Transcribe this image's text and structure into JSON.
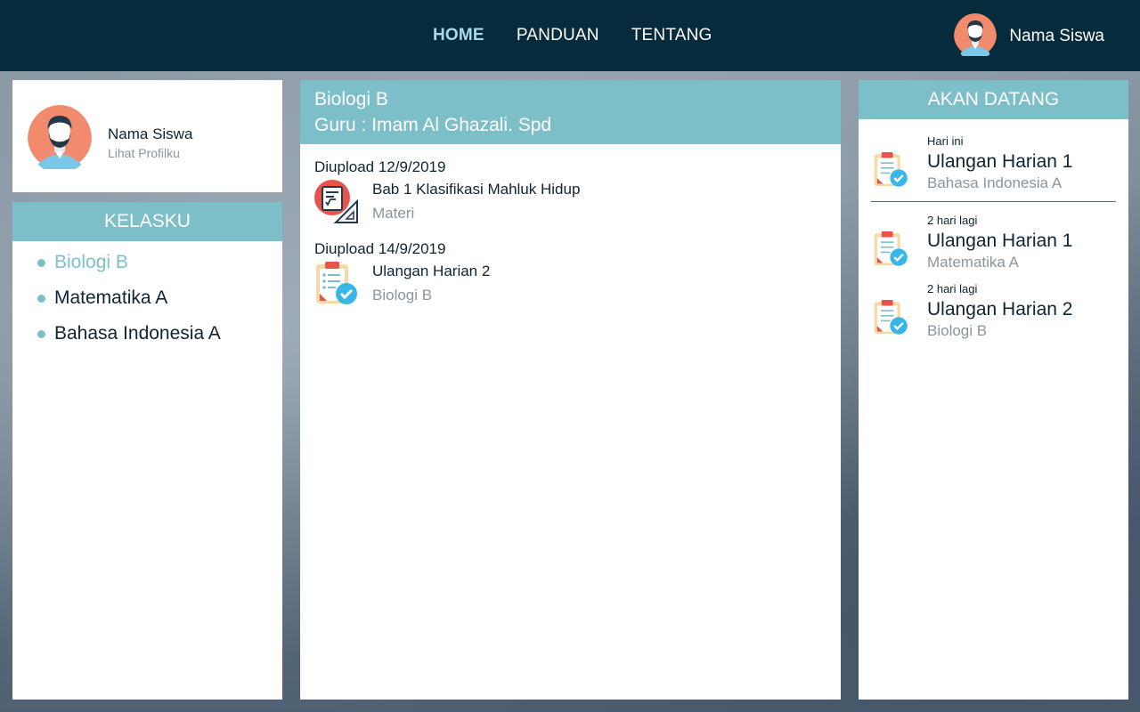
{
  "nav": {
    "items": [
      {
        "label": "HOME",
        "active": true
      },
      {
        "label": "PANDUAN",
        "active": false
      },
      {
        "label": "TENTANG",
        "active": false
      }
    ],
    "user_name": "Nama Siswa"
  },
  "profile": {
    "name": "Nama Siswa",
    "link": "Lihat Profilku"
  },
  "kelasku": {
    "header": "KELASKU",
    "items": [
      {
        "label": "Biologi B",
        "active": true
      },
      {
        "label": "Matematika A",
        "active": false
      },
      {
        "label": "Bahasa Indonesia A",
        "active": false
      }
    ]
  },
  "main": {
    "course": "Biologi B",
    "teacher": "Guru : Imam Al Ghazali. Spd",
    "uploads": [
      {
        "date": "Diupload 12/9/2019",
        "title": "Bab 1 Klasifikasi Mahluk Hidup",
        "sub": "Materi",
        "icon": "material-icon"
      },
      {
        "date": "Diupload 14/9/2019",
        "title": "Ulangan Harian 2",
        "sub": "Biologi B",
        "icon": "quiz-clipboard-icon"
      }
    ]
  },
  "upcoming": {
    "header": "AKAN DATANG",
    "items": [
      {
        "when": "Hari ini",
        "title": "Ulangan Harian 1",
        "sub": "Bahasa Indonesia A"
      },
      {
        "when": "2 hari lagi",
        "title": "Ulangan Harian 1",
        "sub": "Matematika A"
      },
      {
        "when": "2 hari lagi",
        "title": "Ulangan Harian 2",
        "sub": "Biologi B"
      }
    ]
  },
  "colors": {
    "topbar": "#052b3d",
    "accent": "#7dbfc8",
    "text": "#0f2433",
    "muted": "#8a959c"
  }
}
